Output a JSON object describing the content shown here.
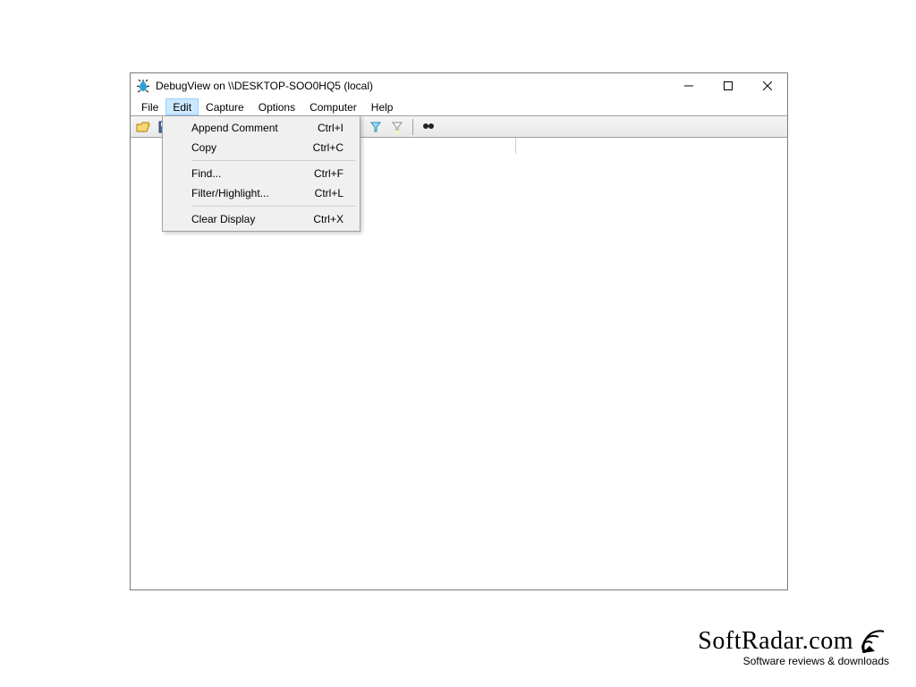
{
  "title": "DebugView on \\\\DESKTOP-SOO0HQ5 (local)",
  "menubar": {
    "file": "File",
    "edit": "Edit",
    "capture": "Capture",
    "options": "Options",
    "computer": "Computer",
    "help": "Help"
  },
  "edit_menu": {
    "append_comment": {
      "label": "Append Comment",
      "shortcut": "Ctrl+I"
    },
    "copy": {
      "label": "Copy",
      "shortcut": "Ctrl+C"
    },
    "find": {
      "label": "Find...",
      "shortcut": "Ctrl+F"
    },
    "filter": {
      "label": "Filter/Highlight...",
      "shortcut": "Ctrl+L"
    },
    "clear": {
      "label": "Clear Display",
      "shortcut": "Ctrl+X"
    }
  },
  "list": {
    "column1": "#"
  },
  "watermark": {
    "brand": "SoftRadar.com",
    "tagline": "Software reviews & downloads"
  }
}
